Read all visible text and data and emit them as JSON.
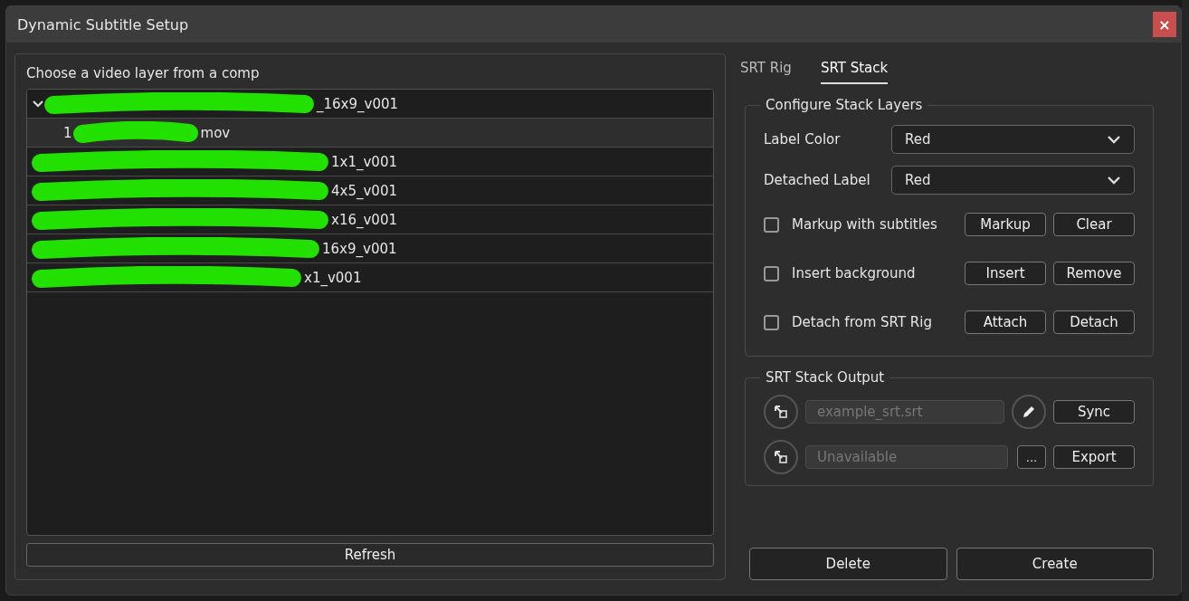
{
  "window": {
    "title": "Dynamic Subtitle Setup",
    "close": "×"
  },
  "layer_panel": {
    "title": "Choose a video layer from a comp",
    "tree": [
      {
        "suffix": "_16x9_v001",
        "expanded": true,
        "selected": false,
        "children": [
          {
            "prefix": "1",
            "suffix": "mov",
            "selected": true
          }
        ]
      },
      {
        "suffix": "1x1_v001",
        "selected": false
      },
      {
        "suffix": "4x5_v001",
        "selected": false
      },
      {
        "suffix": "x16_v001",
        "selected": false
      },
      {
        "suffix": "16x9_v001",
        "selected": false
      },
      {
        "suffix": "x1_v001",
        "selected": false
      }
    ],
    "refresh": "Refresh"
  },
  "tabs": [
    {
      "label": "SRT Rig",
      "selected": false
    },
    {
      "label": "SRT Stack",
      "selected": true
    }
  ],
  "configure": {
    "title": "Configure Stack Layers",
    "selects": [
      {
        "label": "Label Color",
        "value": "Red"
      },
      {
        "label": "Detached Label",
        "value": "Red"
      }
    ],
    "options": [
      {
        "label": "Markup with subtitles",
        "checked": false,
        "buttons": [
          "Markup",
          "Clear"
        ]
      },
      {
        "label": "Insert background",
        "checked": false,
        "buttons": [
          "Insert",
          "Remove"
        ]
      },
      {
        "label": "Detach from SRT Rig",
        "checked": false,
        "buttons": [
          "Attach",
          "Detach"
        ]
      }
    ]
  },
  "output": {
    "title": "SRT Stack Output",
    "rows": [
      {
        "placeholder": "example_srt.srt",
        "kind": "edit",
        "button": "Sync"
      },
      {
        "placeholder": "Unavailable",
        "kind": "browse",
        "browse": "...",
        "button": "Export"
      }
    ]
  },
  "footer": [
    "Delete",
    "Create"
  ]
}
